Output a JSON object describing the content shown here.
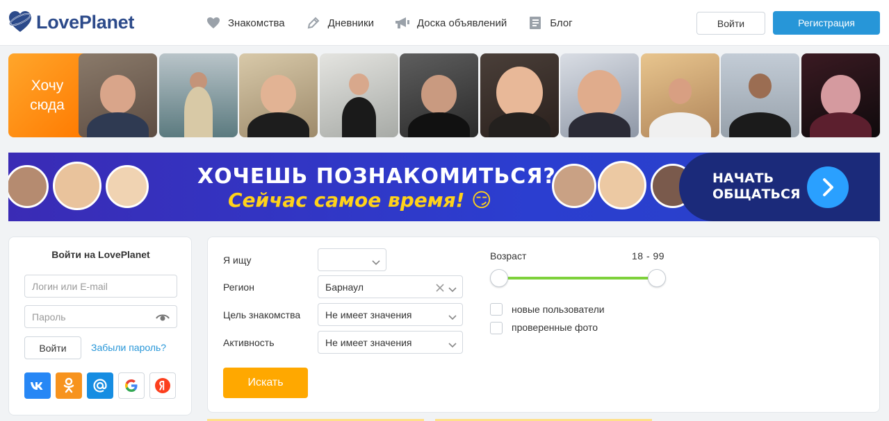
{
  "header": {
    "logo_text": "LovePlanet",
    "nav": [
      {
        "label": "Знакомства",
        "icon": "heart-icon"
      },
      {
        "label": "Дневники",
        "icon": "pencil-icon"
      },
      {
        "label": "Доска объявлений",
        "icon": "megaphone-icon"
      },
      {
        "label": "Блог",
        "icon": "notebook-icon"
      }
    ],
    "login_label": "Войти",
    "register_label": "Регистрация"
  },
  "photo_strip": {
    "want_here_label": "Хочу сюда",
    "thumb_count": 10
  },
  "banner": {
    "title": "ХОЧЕШЬ ПОЗНАКОМИТЬСЯ?",
    "subtitle": "Сейчас самое время! 😏",
    "cta_line1": "НАЧАТЬ",
    "cta_line2": "ОБЩАТЬСЯ"
  },
  "login": {
    "title": "Войти на LovePlanet",
    "login_placeholder": "Логин или E-mail",
    "password_placeholder": "Пароль",
    "submit_label": "Войти",
    "forgot_label": "Забыли пароль?",
    "social": [
      {
        "name": "vk",
        "glyph": "vk",
        "color": "#2787f5"
      },
      {
        "name": "odnoklassniki",
        "glyph": "ok",
        "color": "#f7931e"
      },
      {
        "name": "mailru",
        "glyph": "@",
        "color": "#168de2"
      },
      {
        "name": "google",
        "glyph": "G",
        "color": "#ffffff"
      },
      {
        "name": "yandex",
        "glyph": "Я",
        "color": "#ffffff"
      }
    ]
  },
  "search": {
    "looking_for_label": "Я ищу",
    "looking_for_value": "",
    "region_label": "Регион",
    "region_value": "Барнаул",
    "goal_label": "Цель знакомства",
    "goal_value": "Не имеет значения",
    "activity_label": "Активность",
    "activity_value": "Не имеет значения",
    "age_label": "Возраст",
    "age_value": "18 - 99",
    "age_min": 18,
    "age_max": 99,
    "new_users_label": "новые пользователи",
    "verified_photo_label": "проверенные фото",
    "new_users_checked": false,
    "verified_photo_checked": false,
    "submit_label": "Искать"
  },
  "colors": {
    "brand_blue": "#2796d8",
    "logo_blue": "#2c4a8a",
    "search_orange": "#ffa800",
    "slider_green": "#7ed13b"
  }
}
